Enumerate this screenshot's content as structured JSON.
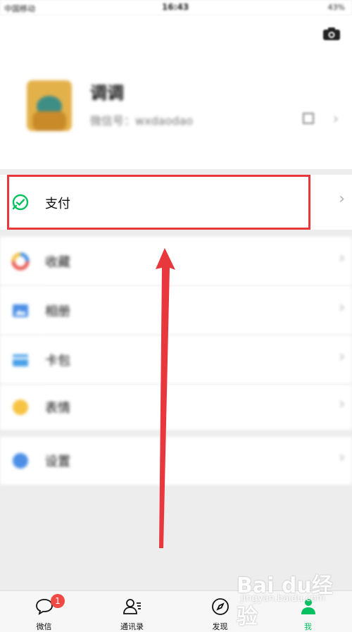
{
  "status_bar": {
    "carrier": "中国移动",
    "time": "16:43",
    "battery": "43%"
  },
  "profile": {
    "nickname": "调调",
    "wechat_id": "微信号：wxdaodao"
  },
  "menu": {
    "pay": "支付",
    "favorites": "收藏",
    "album": "相册",
    "cards": "卡包",
    "stickers": "表情",
    "settings": "设置"
  },
  "tab_bar": {
    "chats": "微信",
    "chats_badge": "1",
    "contacts": "通讯录",
    "discover": "发现",
    "me": "我"
  },
  "colors": {
    "accent_green": "#07c160",
    "highlight_red": "#e8383d",
    "badge_red": "#f04a44"
  },
  "watermark": {
    "brand": "Bai du经验",
    "url": "jingyan.baidu.com"
  }
}
